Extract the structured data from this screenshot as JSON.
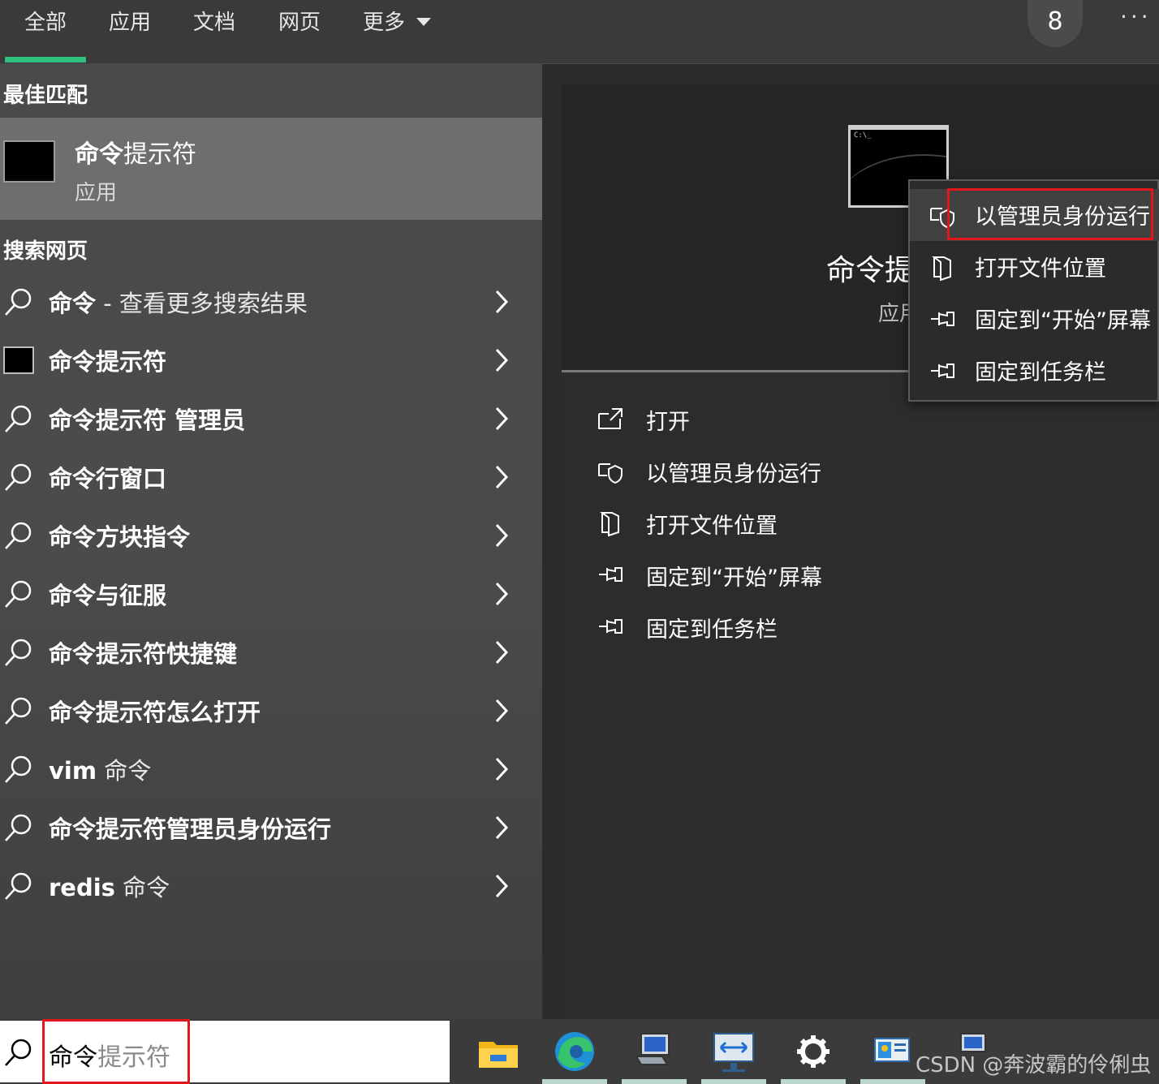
{
  "tabs": [
    {
      "label": "全部"
    },
    {
      "label": "应用"
    },
    {
      "label": "文档"
    },
    {
      "label": "网页"
    },
    {
      "label": "更多"
    }
  ],
  "badge_count": "8",
  "more_menu_glyph": "···",
  "left": {
    "best_match_title": "最佳匹配",
    "best_match": {
      "name_bold": "命令",
      "name_rest": "提示符",
      "type": "应用"
    },
    "search_web_title": "搜索网页",
    "results": [
      {
        "bold": "命令",
        "rest": " - 查看更多搜索结果",
        "icon": "search-icon"
      },
      {
        "bold": "命令提示符",
        "rest": "",
        "icon": "cmd-icon"
      },
      {
        "bold": "命令提示符 管理员",
        "rest": "",
        "icon": "search-icon"
      },
      {
        "bold": "命令行窗口",
        "rest": "",
        "icon": "search-icon"
      },
      {
        "bold": "命令方块指令",
        "rest": "",
        "icon": "search-icon"
      },
      {
        "bold": "命令与征服",
        "rest": "",
        "icon": "search-icon"
      },
      {
        "bold": "命令提示符快捷键",
        "rest": "",
        "icon": "search-icon"
      },
      {
        "bold": "命令提示符怎么打开",
        "rest": "",
        "icon": "search-icon"
      },
      {
        "bold": "vim",
        "rest": " 命令",
        "icon": "search-icon"
      },
      {
        "bold": "命令提示符管理员身份运行",
        "rest": "",
        "icon": "search-icon"
      },
      {
        "bold": "redis",
        "rest": " 命令",
        "icon": "search-icon"
      }
    ]
  },
  "preview": {
    "icon_text": "C:\\_",
    "name": "命令提",
    "type": "应用",
    "actions": [
      {
        "label": "打开",
        "icon": "open-icon"
      },
      {
        "label": "以管理员身份运行",
        "icon": "shield-icon"
      },
      {
        "label": "打开文件位置",
        "icon": "folder-icon"
      },
      {
        "label": "固定到“开始”屏幕",
        "icon": "pin-icon"
      },
      {
        "label": "固定到任务栏",
        "icon": "pin-icon"
      }
    ]
  },
  "context_menu": {
    "items": [
      {
        "label": "以管理员身份运行",
        "icon": "shield-icon"
      },
      {
        "label": "打开文件位置",
        "icon": "folder-icon"
      },
      {
        "label": "固定到“开始”屏幕",
        "icon": "pin-icon"
      },
      {
        "label": "固定到任务栏",
        "icon": "pin-icon"
      }
    ]
  },
  "taskbar": {
    "search_typed": "命令",
    "search_hint": "提示符",
    "apps": [
      "file-explorer-icon",
      "edge-icon",
      "network-computer-icon",
      "remote-desktop-icon",
      "settings-gear-icon",
      "control-panel-icon",
      "network-computer-icon"
    ],
    "watermark": "CSDN @奔波霸的伶俐虫"
  },
  "colors": {
    "accent_green": "#2ec27e",
    "highlight_red": "#e3161b"
  }
}
